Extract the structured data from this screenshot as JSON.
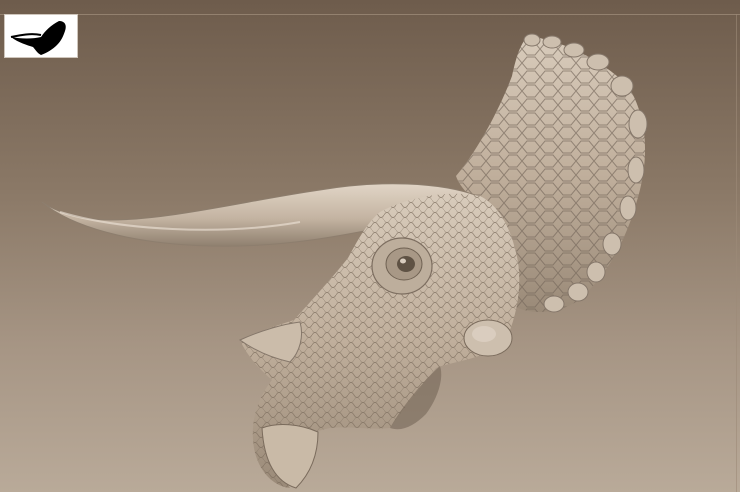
{
  "viewport": {
    "background_top": "#6e5c4c",
    "background_bottom": "#b9aa99"
  },
  "model": {
    "subject": "triceratops-head-sculpt",
    "surface_color": "#c4b4a2",
    "shadow_color": "#6f6152",
    "highlight_color": "#e3d7c9"
  },
  "navigator": {
    "icon": "silhouette-thumbnail-icon"
  }
}
